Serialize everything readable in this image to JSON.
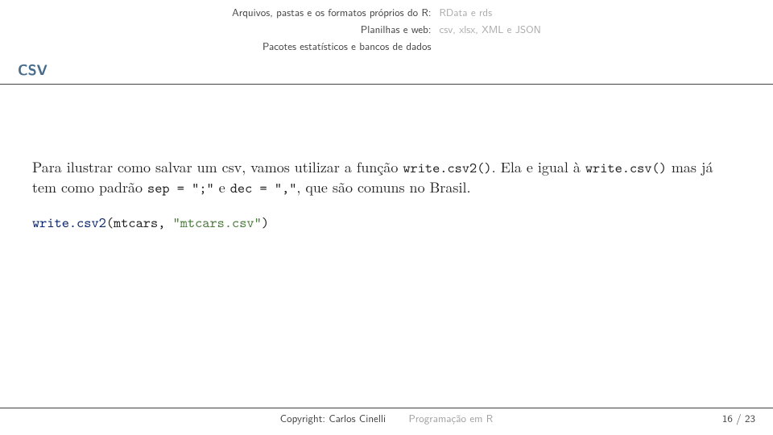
{
  "nav": {
    "rows": [
      {
        "left": "Arquivos, pastas e os formatos próprios do R:",
        "right": "RData e rds"
      },
      {
        "left": "Planilhas e web:",
        "right": "csv, xlsx, XML e JSON"
      },
      {
        "left": "Pacotes estatísticos e bancos de dados",
        "right": ""
      }
    ]
  },
  "section_title": "CSV",
  "body": {
    "para_before_fn1": "Para ilustrar como salvar um csv, vamos utilizar a função ",
    "fn1": "write.csv2()",
    "para_mid1": ". Ela e igual à ",
    "fn2": "write.csv()",
    "para_mid2": " mas já tem como padrão ",
    "opt1": "sep = \";\"",
    "para_mid3": " e ",
    "opt2": "dec = \",\"",
    "para_after": ", que são comuns no Brasil."
  },
  "code": {
    "call_head": "write.csv2",
    "paren_open": "(mtcars, ",
    "string": "\"mtcars.csv\"",
    "paren_close": ")"
  },
  "footer": {
    "copyright": "Copyright: Carlos Cinelli",
    "title": "Programação em R",
    "page": "16 / 23"
  }
}
